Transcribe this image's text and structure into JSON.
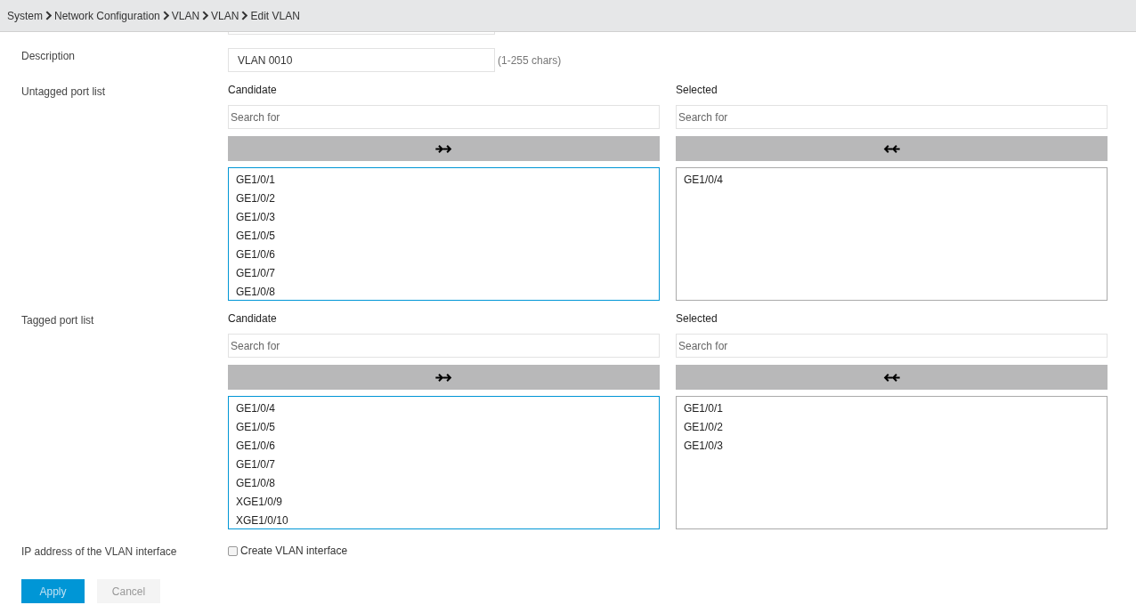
{
  "breadcrumb": [
    "System",
    "Network Configuration",
    "VLAN",
    "VLAN",
    "Edit VLAN"
  ],
  "description": {
    "label": "Description",
    "value": "VLAN 0010",
    "hint": "(1-255 chars)"
  },
  "port_lists": [
    {
      "label": "Untagged port list",
      "panels": [
        {
          "title": "Candidate",
          "placeholder": "Search for",
          "kind": "move-right",
          "focused": true,
          "items": [
            "GE1/0/1",
            "GE1/0/2",
            "GE1/0/3",
            "GE1/0/5",
            "GE1/0/6",
            "GE1/0/7",
            "GE1/0/8"
          ]
        },
        {
          "title": "Selected",
          "placeholder": "Search for",
          "kind": "move-left",
          "focused": false,
          "items": [
            "GE1/0/4"
          ]
        }
      ]
    },
    {
      "label": "Tagged port list",
      "panels": [
        {
          "title": "Candidate",
          "placeholder": "Search for",
          "kind": "move-right",
          "focused": true,
          "items": [
            "GE1/0/4",
            "GE1/0/5",
            "GE1/0/6",
            "GE1/0/7",
            "GE1/0/8",
            "XGE1/0/9",
            "XGE1/0/10"
          ]
        },
        {
          "title": "Selected",
          "placeholder": "Search for",
          "kind": "move-left",
          "focused": false,
          "items": [
            "GE1/0/1",
            "GE1/0/2",
            "GE1/0/3"
          ]
        }
      ]
    }
  ],
  "vlan_interface": {
    "label": "IP address of the VLAN interface",
    "checkbox": {
      "label": "Create VLAN interface",
      "checked": false
    }
  },
  "buttons": [
    {
      "label": "Apply",
      "kind": "primary"
    },
    {
      "label": "Cancel",
      "kind": "secondary"
    }
  ]
}
